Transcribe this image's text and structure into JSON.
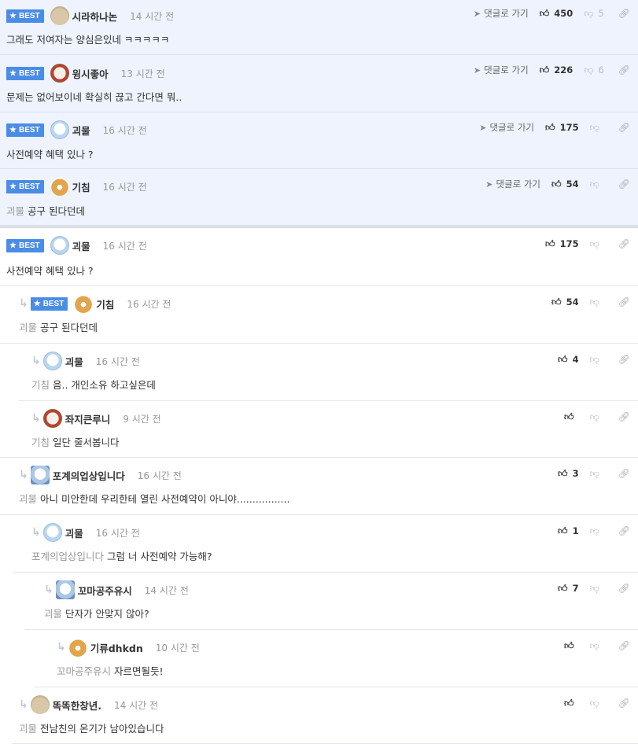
{
  "ui": {
    "best_badge": "BEST",
    "goto_label": "댓글로 가기"
  },
  "best_comments": [
    {
      "nick": "시라하나논",
      "time": "14 시간 전",
      "text": "그래도 저여자는 양심은있네 ㅋㅋㅋㅋㅋ",
      "likes": "450",
      "dislikes": "5",
      "avatar": "beige"
    },
    {
      "nick": "윙시좋아",
      "time": "13 시간 전",
      "text": "문제는 없어보이네 확실히 끊고 간다면 뭐..",
      "likes": "226",
      "dislikes": "6",
      "avatar": "dog"
    },
    {
      "nick": "괴물",
      "time": "16 시간 전",
      "text": "사전예약 혜택 있나 ?",
      "likes": "175",
      "dislikes": "",
      "avatar": "white"
    },
    {
      "nick": "기침",
      "time": "16 시간 전",
      "mention": "괴물",
      "text": "공구 된다던데",
      "likes": "54",
      "dislikes": "",
      "avatar": "fox"
    }
  ],
  "thread": [
    {
      "nick": "괴물",
      "time": "16 시간 전",
      "text": "사전예약 혜택 있나 ?",
      "likes": "175",
      "best": true,
      "avatar": "white"
    },
    {
      "nick": "기침",
      "time": "16 시간 전",
      "mention": "괴물",
      "text": "공구 된다던데",
      "likes": "54",
      "best": true,
      "avatar": "fox"
    },
    {
      "nick": "괴물",
      "time": "16 시간 전",
      "mention": "기침",
      "text": "음.. 개인소유 하고싶은데",
      "likes": "4",
      "avatar": "white"
    },
    {
      "nick": "좌지큰루니",
      "time": "9 시간 전",
      "mention": "기침",
      "text": "일단 줄서봅니다",
      "likes": "",
      "avatar": "dog"
    },
    {
      "nick": "포계의업상입니다",
      "time": "16 시간 전",
      "mention": "괴물",
      "text": "아니 미안한데 우리한테 열린 사전예약이 아니야.................",
      "likes": "3",
      "avatar": "bear"
    },
    {
      "nick": "괴물",
      "time": "16 시간 전",
      "mention": "포계의업상입니다",
      "text": "그럼 너 사전예약 가능해?",
      "likes": "1",
      "avatar": "white"
    },
    {
      "nick": "꼬마공주유시",
      "time": "14 시간 전",
      "mention": "괴물",
      "text": "단자가 안맞지 않아?",
      "likes": "7",
      "avatar": "bear"
    },
    {
      "nick": "기류dhkdn",
      "time": "10 시간 전",
      "mention": "꼬마공주유시",
      "text": "자르면될듯!",
      "likes": "",
      "avatar": "fox"
    },
    {
      "nick": "똑똑한창년.",
      "time": "14 시간 전",
      "mention": "괴물",
      "text": "전남친의 온기가 남아있습니다",
      "likes": "",
      "avatar": "beige"
    }
  ]
}
